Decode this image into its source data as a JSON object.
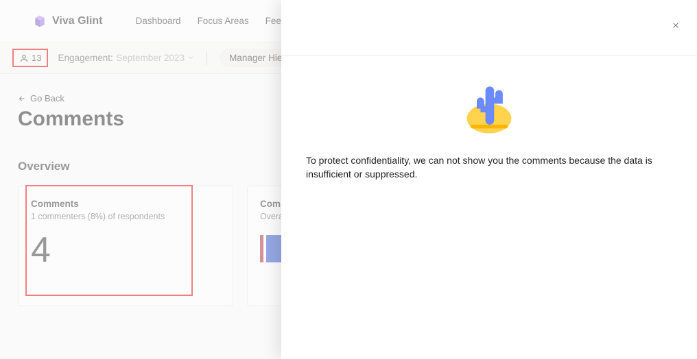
{
  "header": {
    "brand": "Viva Glint",
    "nav": [
      "Dashboard",
      "Focus Areas",
      "Feed"
    ]
  },
  "filterBar": {
    "userCount": "13",
    "engagementLabel": "Engagement:",
    "engagementValue": "September 2023",
    "hierarchyLabel": "Manager Hierarchy:"
  },
  "main": {
    "goBack": "Go Back",
    "title": "Comments",
    "overviewTitle": "Overview",
    "cards": {
      "comments": {
        "title": "Comments",
        "subtitle": "1 commenters (8%) of respondents",
        "value": "4"
      },
      "sentiment": {
        "title": "Comm",
        "subtitle": "Overall"
      }
    }
  },
  "panel": {
    "message": "To protect confidentiality, we can not show you the comments because the data is insufficient or suppressed."
  }
}
